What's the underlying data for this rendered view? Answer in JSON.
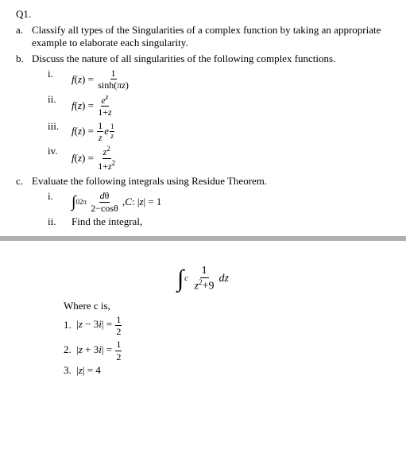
{
  "page": {
    "question_label": "Q1.",
    "section_a": {
      "letter": "a.",
      "text": "Classify all types of the Singularities of a complex function by taking an appropriate example to elaborate each singularity."
    },
    "section_b": {
      "letter": "b.",
      "text": "Discuss the nature of all singularities of the following complex functions.",
      "items": [
        {
          "label": "i.",
          "text": "f(z) = 1/sinh(πz)"
        },
        {
          "label": "ii.",
          "text": "f(z) = e^z/(1+z)"
        },
        {
          "label": "iii.",
          "text": "f(z) = (1/z)e^(1/z)"
        },
        {
          "label": "iv.",
          "text": "f(z) = z²/(1+z²)"
        }
      ]
    },
    "section_c": {
      "letter": "c.",
      "text": "Evaluate the following integrals using Residue Theorem.",
      "items": [
        {
          "label": "i.",
          "text": "∫₀²π dθ/(2-cosθ), C:|z|=1"
        },
        {
          "label": "ii.",
          "text": "Find the integral,"
        }
      ]
    },
    "integral_display": "∫_c 1/(z²+9) dz",
    "where_label": "Where c is,",
    "where_items": [
      {
        "num": "1.",
        "text": "|z − 3i| = 1/2"
      },
      {
        "num": "2.",
        "text": "|z + 3i| = 1/2"
      },
      {
        "num": "3.",
        "text": "|z| = 4"
      }
    ]
  }
}
